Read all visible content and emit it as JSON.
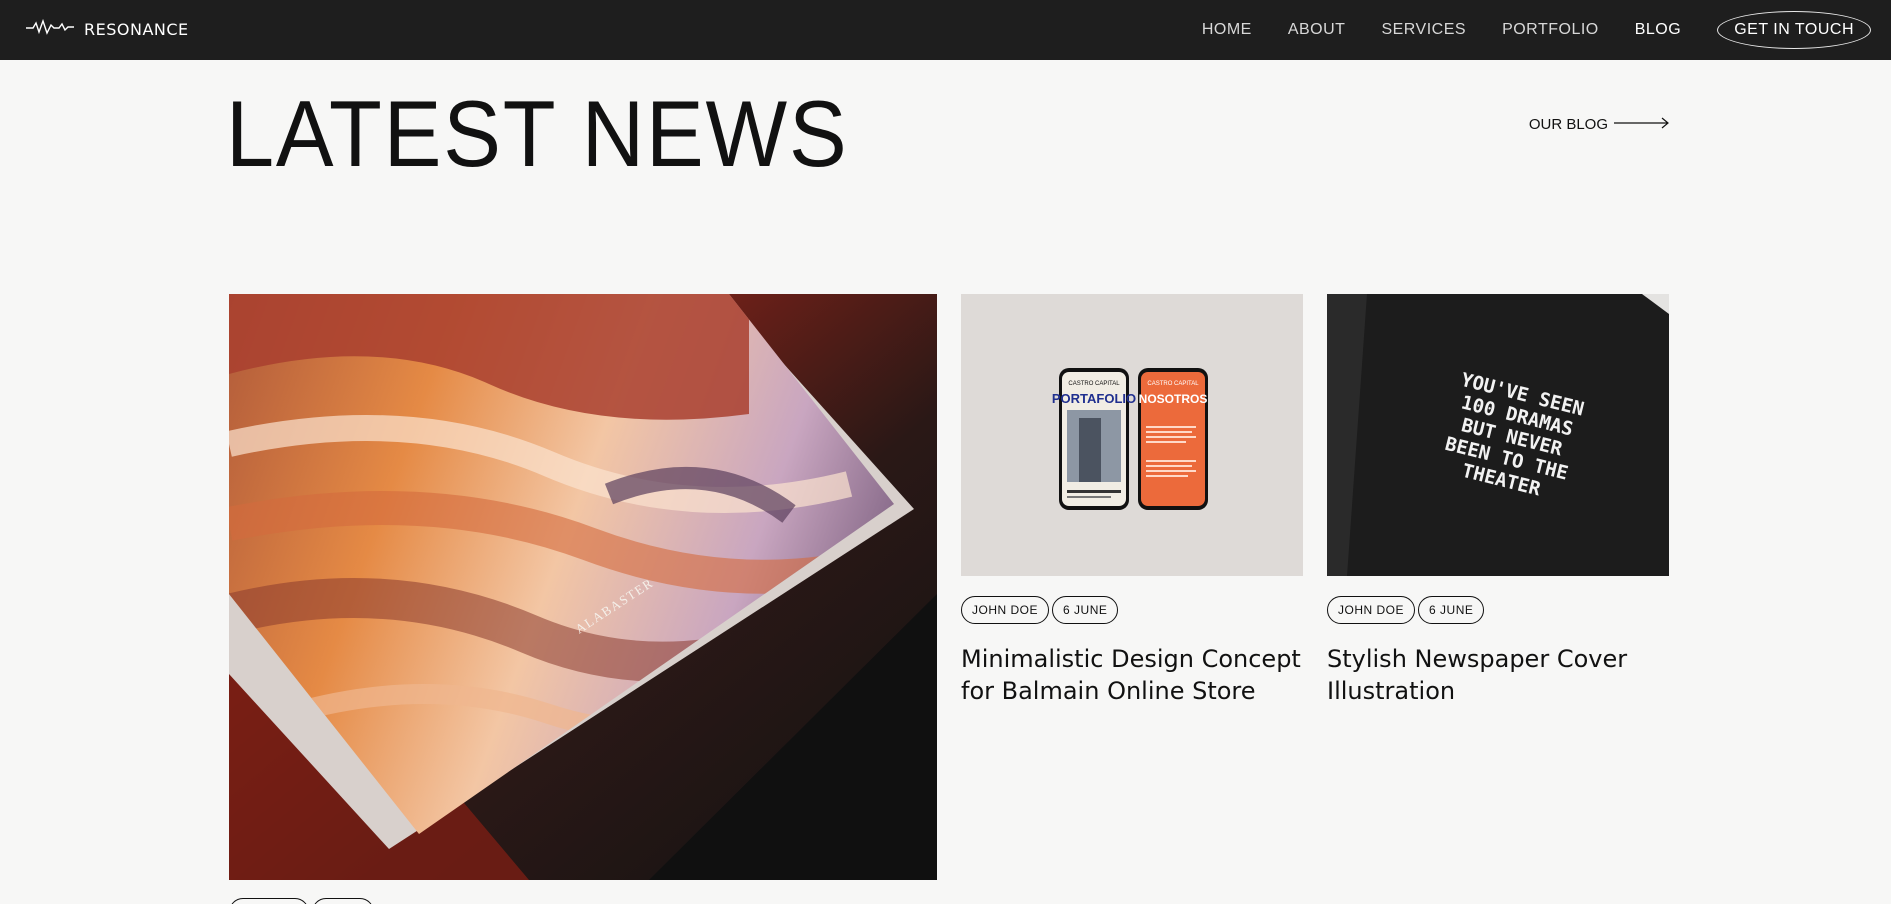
{
  "header": {
    "logo_text": "RESONANCE",
    "nav": [
      "HOME",
      "ABOUT",
      "SERVICES",
      "PORTFOLIO",
      "BLOG"
    ],
    "active_nav": "BLOG",
    "cta_label": "GET IN TOUCH"
  },
  "main": {
    "title": "LATEST NEWS",
    "blog_link_label": "OUR BLOG",
    "cards": [
      {
        "image": "canyon-print-photo",
        "image_text": "ALABASTER",
        "author": "",
        "date": "",
        "title": ""
      },
      {
        "image": "phone-mockups-photo",
        "image_text": [
          "CASTRO CAPITAL",
          "PORTAFOLIO",
          "CASTRO CAPITAL",
          "NOSOTROS"
        ],
        "author": "JOHN DOE",
        "date": "6 JUNE",
        "title": "Minimalistic Design Concept for Balmain Online Store"
      },
      {
        "image": "newspaper-cover-photo",
        "image_text": [
          "YOU'VE SEEN",
          "100 DRAMAS",
          "BUT NEVER",
          "BEEN TO THE",
          "THEATER"
        ],
        "author": "JOHN DOE",
        "date": "6 JUNE",
        "title": "Stylish Newspaper Cover Illustration"
      }
    ]
  },
  "colors": {
    "header_bg": "#1e1e1e",
    "page_bg": "#f7f7f6",
    "text": "#111111",
    "accent_orange": "#ec6a3b"
  }
}
